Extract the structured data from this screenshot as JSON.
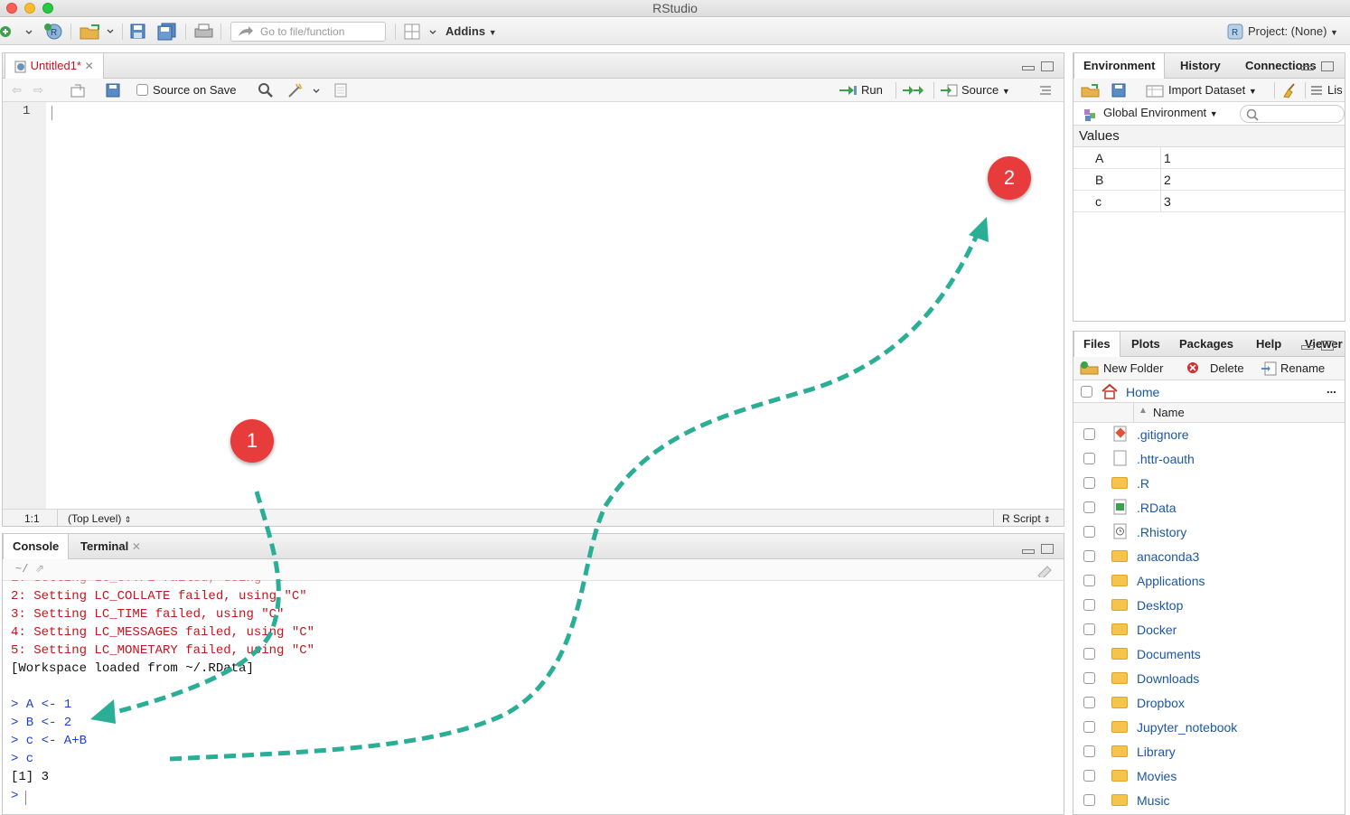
{
  "window": {
    "title": "RStudio"
  },
  "toolbar": {
    "goto_placeholder": "Go to file/function",
    "addins": "Addins",
    "project": "Project: (None)"
  },
  "source": {
    "tab": "Untitled1*",
    "source_on_save": "Source on Save",
    "run": "Run",
    "source_btn": "Source",
    "line_no": "1",
    "status_pos": "1:1",
    "status_level": "(Top Level)",
    "status_type": "R Script"
  },
  "console": {
    "tabs": [
      "Console",
      "Terminal"
    ],
    "path": "~/",
    "errors": [
      "2: Setting LC_COLLATE failed, using \"C\"",
      "3: Setting LC_TIME failed, using \"C\"",
      "4: Setting LC_MESSAGES failed, using \"C\"",
      "5: Setting LC_MONETARY failed, using \"C\""
    ],
    "workspace": "[Workspace loaded from ~/.RData]",
    "commands": [
      "> A <- 1",
      "> B <- 2",
      "> c <- A+B",
      "> c"
    ],
    "output": "[1] 3",
    "prompt": ">"
  },
  "environment": {
    "tabs": [
      "Environment",
      "History",
      "Connections"
    ],
    "import_dataset": "Import Dataset",
    "list_label": "Lis",
    "scope": "Global Environment",
    "values_header": "Values",
    "values": [
      {
        "name": "A",
        "value": "1"
      },
      {
        "name": "B",
        "value": "2"
      },
      {
        "name": "c",
        "value": "3"
      }
    ]
  },
  "files": {
    "tabs": [
      "Files",
      "Plots",
      "Packages",
      "Help",
      "Viewer"
    ],
    "new_folder": "New Folder",
    "delete": "Delete",
    "rename": "Rename",
    "home": "Home",
    "more": "...",
    "name_header": "Name",
    "items": [
      ".gitignore",
      ".httr-oauth",
      ".R",
      ".RData",
      ".Rhistory",
      "anaconda3",
      "Applications",
      "Desktop",
      "Docker",
      "Documents",
      "Downloads",
      "Dropbox",
      "Jupyter_notebook",
      "Library",
      "Movies",
      "Music"
    ]
  },
  "annotations": {
    "badge1": "1",
    "badge2": "2"
  },
  "colors": {
    "badge": "#e83b3b",
    "arrow": "#2bae96",
    "error_text": "#c4161c",
    "command_text": "#1b3fcf",
    "link_text": "#1c57a5"
  }
}
